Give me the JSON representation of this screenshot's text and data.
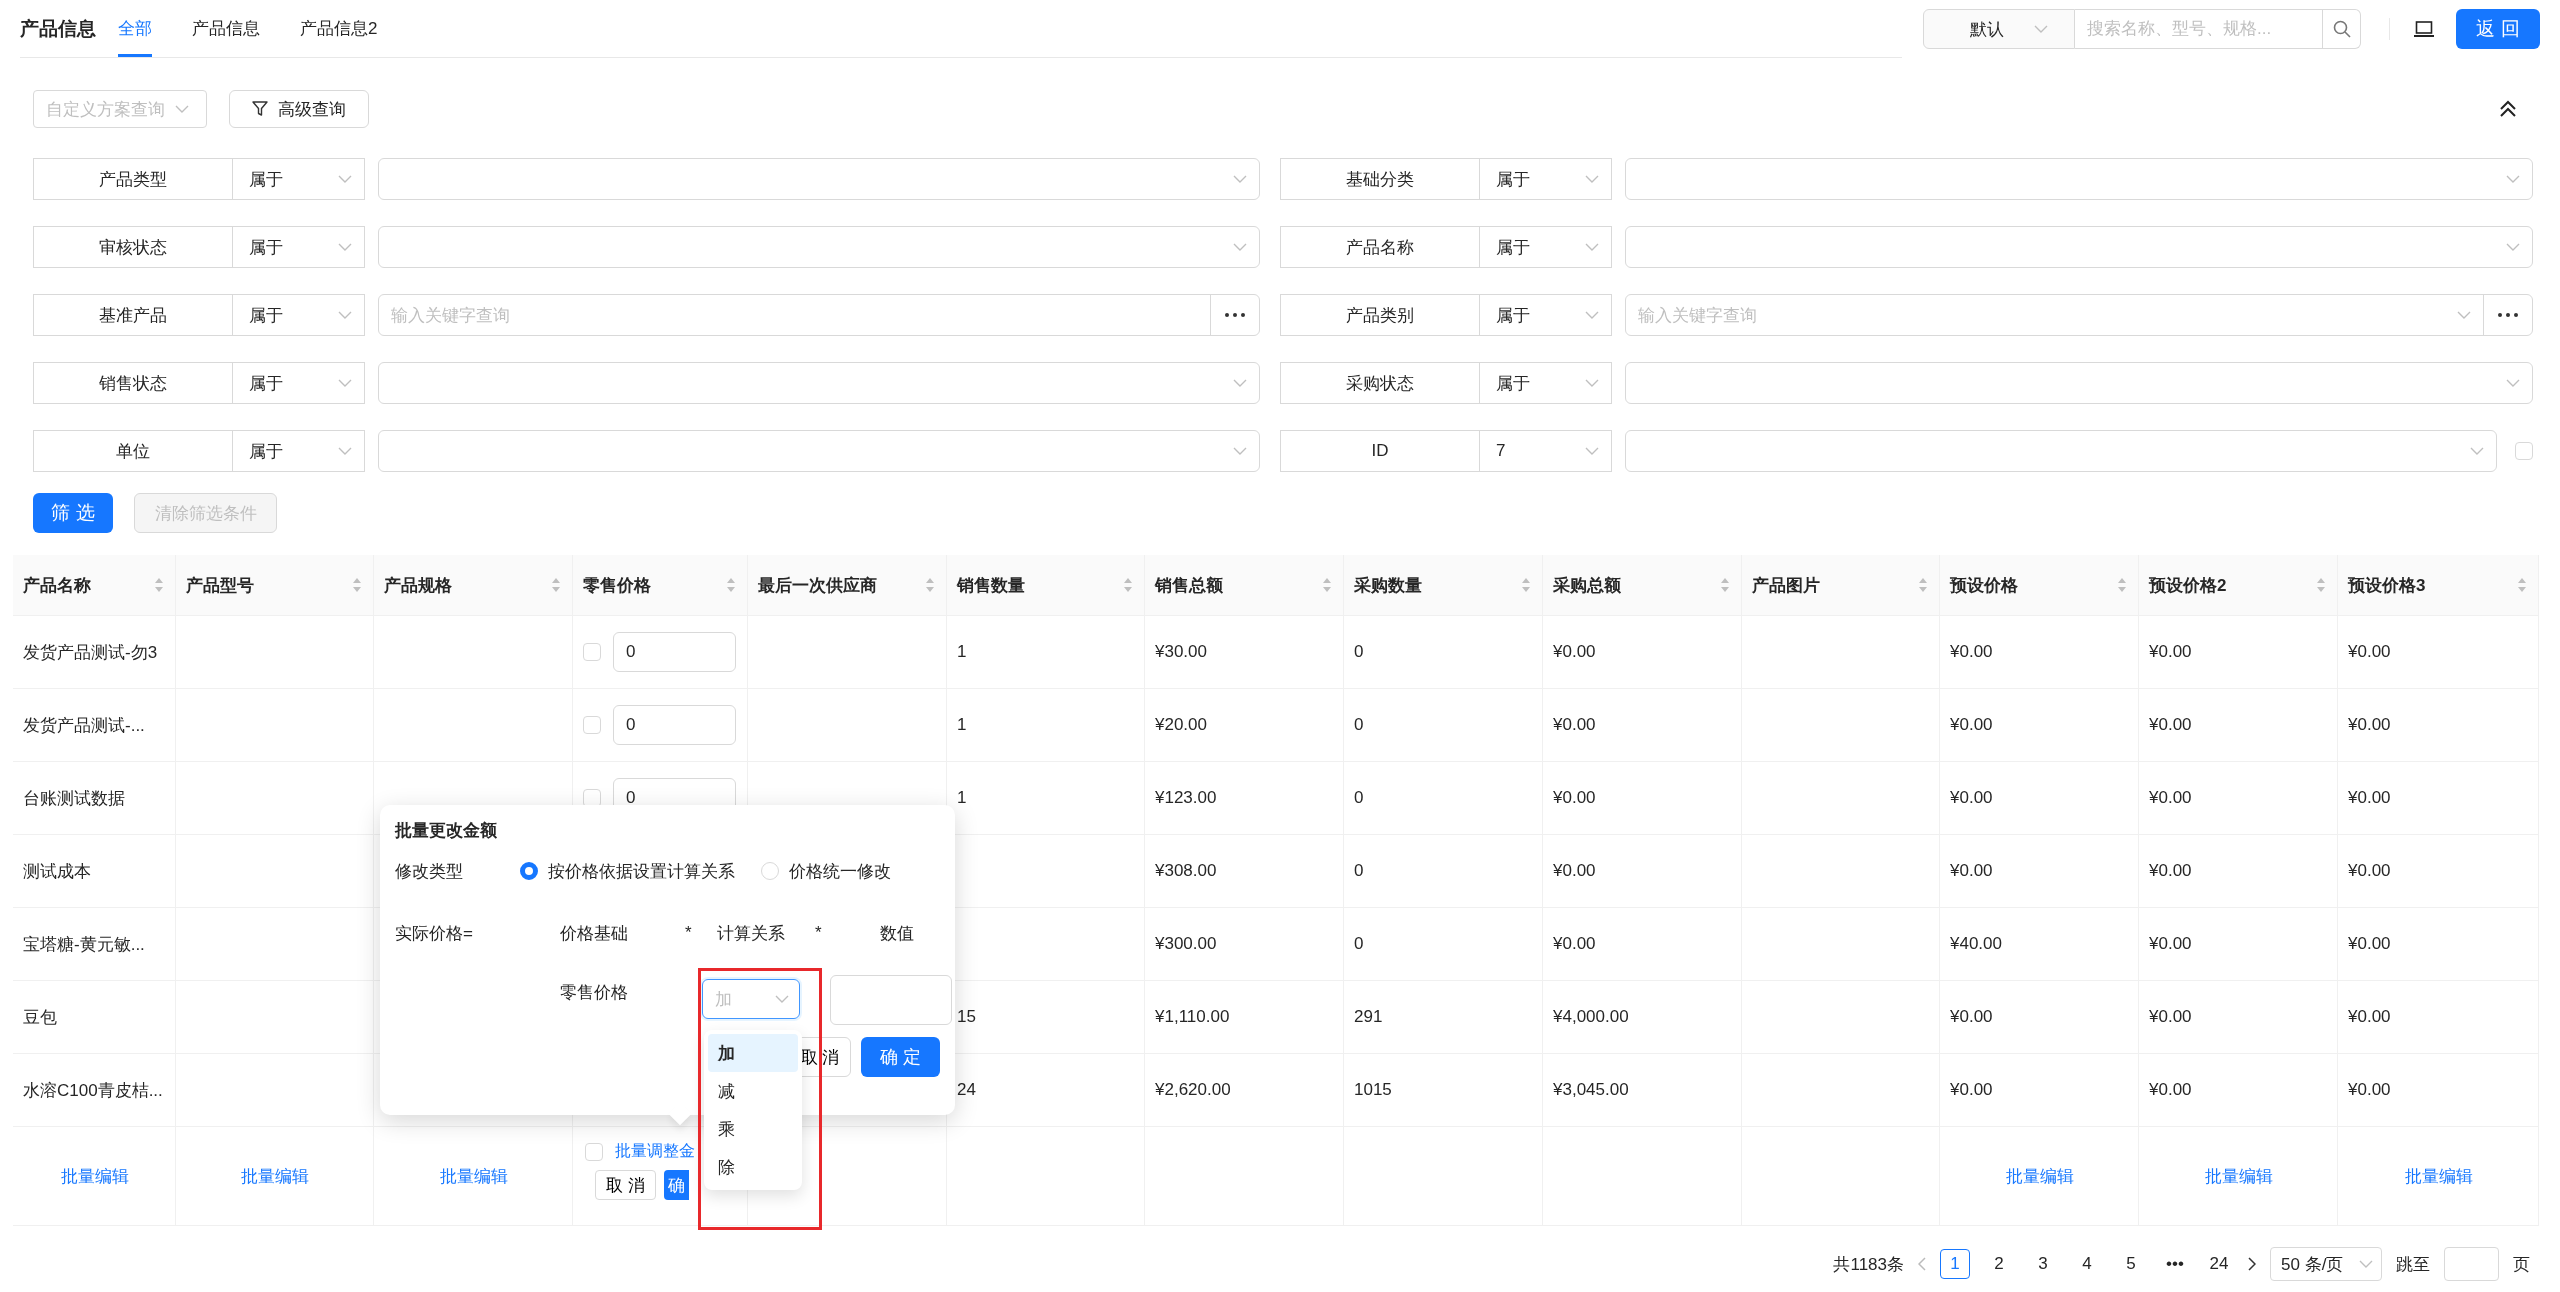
{
  "header": {
    "title": "产品信息",
    "tabs": [
      {
        "label": "全部",
        "selected": true
      },
      {
        "label": "产品信息",
        "selected": false
      },
      {
        "label": "产品信息2",
        "selected": false
      }
    ],
    "scope": "默认",
    "search_placeholder": "搜索名称、型号、规格...",
    "back": "返 回"
  },
  "toolbar": {
    "scheme_placeholder": "自定义方案查询",
    "advanced": "高级查询"
  },
  "filters": [
    {
      "left": {
        "label": "产品类型",
        "operator": "属于",
        "kind": "select"
      },
      "right": {
        "label": "基础分类",
        "operator": "属于",
        "kind": "select"
      }
    },
    {
      "left": {
        "label": "审核状态",
        "operator": "属于",
        "kind": "select"
      },
      "right": {
        "label": "产品名称",
        "operator": "属于",
        "kind": "select"
      }
    },
    {
      "left": {
        "label": "基准产品",
        "operator": "属于",
        "kind": "lookup",
        "placeholder": "输入关键字查询"
      },
      "right": {
        "label": "产品类别",
        "operator": "属于",
        "kind": "select_lookup",
        "placeholder": "输入关键字查询"
      }
    },
    {
      "left": {
        "label": "销售状态",
        "operator": "属于",
        "kind": "select"
      },
      "right": {
        "label": "采购状态",
        "operator": "属于",
        "kind": "select"
      }
    },
    {
      "left": {
        "label": "单位",
        "operator": "属于",
        "kind": "select"
      },
      "right": {
        "label": "ID",
        "operator": "7",
        "kind": "select",
        "checkbox": {
          "checked": false
        }
      }
    }
  ],
  "filter_buttons": {
    "apply": "筛 选",
    "clear": "清除筛选条件"
  },
  "table": {
    "columns": [
      "产品名称",
      "产品型号",
      "产品规格",
      "零售价格",
      "最后一次供应商",
      "销售数量",
      "销售总额",
      "采购数量",
      "采购总额",
      "产品图片",
      "预设价格",
      "预设价格2",
      "预设价格3"
    ],
    "rows": [
      {
        "cells": [
          "发货产品测试-勿3",
          null,
          null,
          {
            "kind": "price_input",
            "checked": false,
            "value": "0"
          },
          null,
          "1",
          "¥30.00",
          "0",
          "¥0.00",
          null,
          "¥0.00",
          "¥0.00",
          "¥0.00"
        ]
      },
      {
        "cells": [
          "发货产品测试-...",
          null,
          null,
          {
            "kind": "price_input",
            "checked": false,
            "value": "0"
          },
          null,
          "1",
          "¥20.00",
          "0",
          "¥0.00",
          null,
          "¥0.00",
          "¥0.00",
          "¥0.00"
        ]
      },
      {
        "cells": [
          "台账测试数据",
          null,
          null,
          {
            "kind": "price_input",
            "checked": false,
            "value": "0"
          },
          null,
          "1",
          "¥123.00",
          "0",
          "¥0.00",
          null,
          "¥0.00",
          "¥0.00",
          "¥0.00"
        ]
      },
      {
        "cells": [
          "测试成本",
          null,
          null,
          null,
          null,
          null,
          "¥308.00",
          "0",
          "¥0.00",
          null,
          "¥0.00",
          "¥0.00",
          "¥0.00"
        ]
      },
      {
        "cells": [
          "宝塔糖-黄元敏...",
          null,
          null,
          null,
          null,
          null,
          "¥300.00",
          "0",
          "¥0.00",
          null,
          "¥40.00",
          "¥0.00",
          "¥0.00"
        ]
      },
      {
        "cells": [
          "豆包",
          null,
          null,
          null,
          null,
          "15",
          "¥1,110.00",
          "291",
          "¥4,000.00",
          null,
          "¥0.00",
          "¥0.00",
          "¥0.00"
        ]
      },
      {
        "cells": [
          "水溶C100青皮桔...",
          null,
          null,
          null,
          null,
          "24",
          "¥2,620.00",
          "1015",
          "¥3,045.00",
          null,
          "¥0.00",
          "¥0.00",
          "¥0.00"
        ]
      }
    ],
    "batch_row": [
      {
        "kind": "link",
        "label": "批量编辑"
      },
      {
        "kind": "link",
        "label": "批量编辑"
      },
      {
        "kind": "link",
        "label": "批量编辑"
      },
      {
        "kind": "batch_adjust",
        "checked": false,
        "link": "批量调整金",
        "cancel": "取 消",
        "confirm": "确"
      },
      {
        "kind": "empty"
      },
      {
        "kind": "empty"
      },
      {
        "kind": "empty"
      },
      {
        "kind": "empty"
      },
      {
        "kind": "empty"
      },
      {
        "kind": "empty"
      },
      {
        "kind": "link",
        "label": "批量编辑"
      },
      {
        "kind": "link",
        "label": "批量编辑"
      },
      {
        "kind": "link",
        "label": "批量编辑"
      }
    ]
  },
  "pagination": {
    "total": "共1183条",
    "pages": [
      {
        "label": "1",
        "selected": true
      },
      {
        "label": "2",
        "selected": false
      },
      {
        "label": "3",
        "selected": false
      },
      {
        "label": "4",
        "selected": false
      },
      {
        "label": "5",
        "selected": false
      },
      {
        "label": "•••",
        "selected": false
      },
      {
        "label": "24",
        "selected": false
      }
    ],
    "page_size": "50 条/页",
    "jump_label": "跳至",
    "page_suffix": "页"
  },
  "batch_popup": {
    "title": "批量更改金额",
    "type_label": "修改类型",
    "type_options": [
      {
        "label": "按价格依据设置计算关系",
        "selected": true
      },
      {
        "label": "价格统一修改",
        "selected": false
      }
    ],
    "formula": [
      "实际价格=",
      "价格基础",
      "*",
      "计算关系",
      "*",
      "数值"
    ],
    "base_label": "零售价格",
    "operation": {
      "placeholder": "加",
      "options": [
        {
          "label": "加",
          "selected": true
        },
        {
          "label": "减",
          "selected": false
        },
        {
          "label": "乘",
          "selected": false
        },
        {
          "label": "除",
          "selected": false
        }
      ]
    },
    "cancel": "取 消",
    "confirm": "确 定"
  }
}
